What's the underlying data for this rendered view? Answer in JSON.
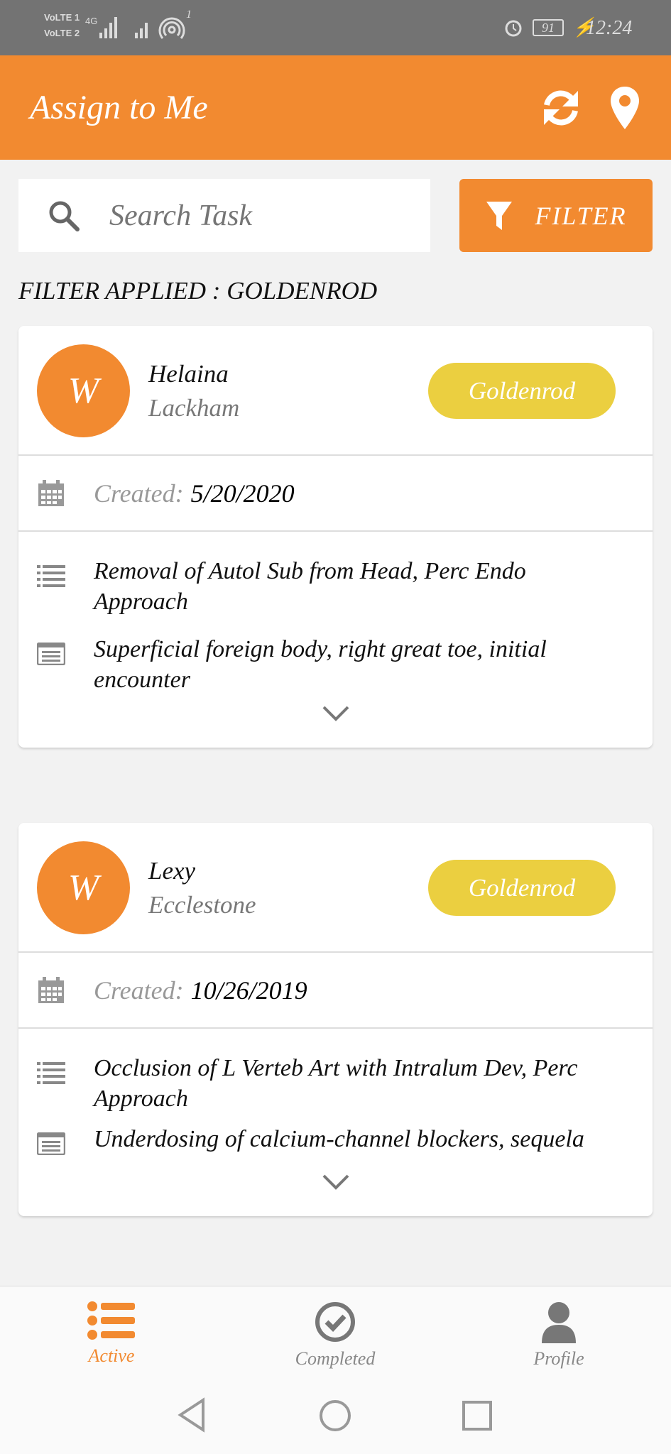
{
  "status_bar": {
    "sim1": "VoLTE 1",
    "sim2": "VoLTE 2",
    "network": "4G",
    "hotspot_count": "1",
    "battery": "91",
    "time": "12:24"
  },
  "header": {
    "title": "Assign to Me",
    "icons": [
      "refresh-icon",
      "location-pin-icon"
    ]
  },
  "search": {
    "placeholder": "Search Task",
    "value": ""
  },
  "filter": {
    "label": "FILTER",
    "applied": "FILTER APPLIED : GOLDENROD"
  },
  "colors": {
    "primary": "#f28a30",
    "badge": "#ebcf40"
  },
  "tasks": [
    {
      "initial": "W",
      "first": "Helaina",
      "last": "Lackham",
      "badge": "Goldenrod",
      "created_label": "Created:",
      "created": "5/20/2020",
      "procedure": "Removal of Autol Sub from Head, Perc Endo Approach",
      "diagnosis": "Superficial foreign body, right great toe, initial encounter"
    },
    {
      "initial": "W",
      "first": "Lexy",
      "last": "Ecclestone",
      "badge": "Goldenrod",
      "created_label": "Created:",
      "created": "10/26/2019",
      "procedure": "Occlusion of L Verteb Art with Intralum Dev, Perc Approach",
      "diagnosis": "Underdosing of calcium-channel blockers, sequela"
    }
  ],
  "bottom_nav": {
    "items": [
      {
        "label": "Active",
        "active": true
      },
      {
        "label": "Completed"
      },
      {
        "label": "Profile"
      }
    ]
  }
}
